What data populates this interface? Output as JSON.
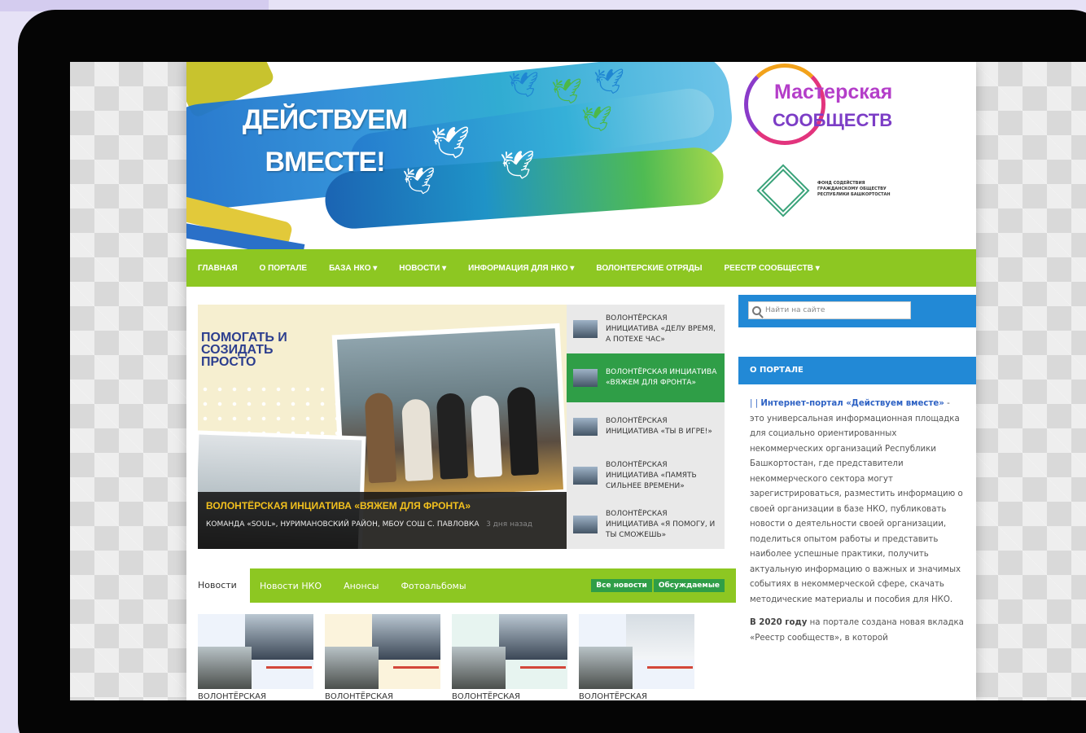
{
  "banner": {
    "slogan_line1": "ДЕЙСТВУЕМ",
    "slogan_line2": "ВМЕСТЕ!",
    "logo_title": "Мастерская",
    "logo_subtitle": "СООБЩЕСТВ",
    "fund_text": "ФОНД СОДЕЙСТВИЯ ГРАЖДАНСКОМУ ОБЩЕСТВУ РЕСПУБЛИКИ БАШКОРТОСТАН"
  },
  "nav": {
    "items": [
      {
        "label": "ГЛАВНАЯ"
      },
      {
        "label": "О ПОРТАЛЕ"
      },
      {
        "label": "БАЗА НКО ▾"
      },
      {
        "label": "НОВОСТИ ▾"
      },
      {
        "label": "ИНФОРМАЦИЯ ДЛЯ НКО ▾"
      },
      {
        "label": "ВОЛОНТЕРСКИЕ ОТРЯДЫ"
      },
      {
        "label": "РЕЕСТР СООБЩЕСТВ ▾"
      }
    ]
  },
  "slider": {
    "tagline": "ПОМОГАТЬ И СОЗИДАТЬ ПРОСТО",
    "caption_title": "ВОЛОНТЁРСКАЯ ИНЦИАТИВА «ВЯЖЕМ ДЛЯ ФРОНТА»",
    "caption_subtitle": "КОМАНДА «SOUL», НУРИМАНОВСКИЙ РАЙОН, МБОУ СОШ С. ПАВЛОВКА",
    "caption_time": "3 дня назад"
  },
  "side_list": [
    {
      "label": "ВОЛОНТЁРСКАЯ ИНИЦИАТИВА «ДЕЛУ ВРЕМЯ, А ПОТЕХЕ ЧАС»"
    },
    {
      "label": "ВОЛОНТЁРСКАЯ ИНЦИАТИВА «ВЯЖЕМ ДЛЯ ФРОНТА»"
    },
    {
      "label": "ВОЛОНТЁРСКАЯ ИНИЦИАТИВА «ТЫ В ИГРЕ!»"
    },
    {
      "label": "ВОЛОНТЁРСКАЯ ИНИЦИАТИВА «ПАМЯТЬ СИЛЬНЕЕ ВРЕМЕНИ»"
    },
    {
      "label": "ВОЛОНТЁРСКАЯ ИНИЦИАТИВА «Я ПОМОГУ, И ТЫ СМОЖЕШЬ»"
    }
  ],
  "tabs": {
    "first": "Новости",
    "links": [
      "Новости НКО",
      "Анонсы",
      "Фотоальбомы"
    ],
    "btn_all": "Все новости",
    "btn_discussed": "Обсуждаемые"
  },
  "news_cards": [
    {
      "title": "ВОЛОНТЁРСКАЯ"
    },
    {
      "title": "ВОЛОНТЁРСКАЯ"
    },
    {
      "title": "ВОЛОНТЁРСКАЯ"
    },
    {
      "title": "ВОЛОНТЁРСКАЯ"
    }
  ],
  "search": {
    "placeholder": "Найти на сайте"
  },
  "about": {
    "heading": "О ПОРТАЛЕ",
    "lead_prefix": "| | ",
    "lead_highlight": "Интернет-портал «Действуем вместе»",
    "lead_text": " - это универсальная информационная площадка для социально ориентированных некоммерческих организаций Республики Башкортостан, где представители некоммерческого сектора могут зарегистрироваться, разместить информацию о своей организации в базе НКО, публиковать новости о деятельности своей организации, поделиться опытом работы и представить наиболее успешные практики, получить актуальную информацию о важных и значимых событиях в некоммерческой сфере, скачать методические материалы и пособия для НКО.",
    "p2_bold": "В 2020 году",
    "p2_text": " на портале создана новая вкладка «Реестр сообществ», в которой"
  },
  "colors": {
    "nav_green": "#8dc722",
    "active_green": "#2f9e47",
    "blue": "#2289d6",
    "caption_yellow": "#f2c01e"
  }
}
